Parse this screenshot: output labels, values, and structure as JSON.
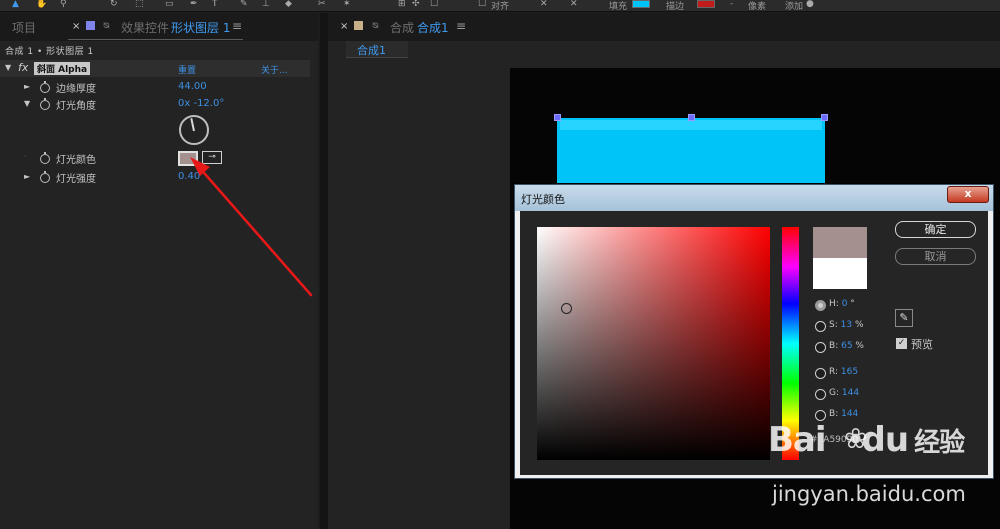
{
  "toolbar": {
    "align_label": "对齐",
    "fill_label": "填充",
    "stroke_label": "描边",
    "px_label": "像素",
    "add_label": "添加",
    "fill_color": "#00c3f7",
    "stroke_color": "#c21b1b"
  },
  "left_panel": {
    "tab_project": "项目",
    "tab_effects_prefix": "效果控件",
    "tab_effects_layer": "形状图层 1",
    "menu_glyph": "≡",
    "breadcrumb": "合成 1 • 形状图层 1",
    "effect": {
      "fx_glyph": "fx",
      "name": "斜面 Alpha",
      "reset": "重置",
      "about": "关于..."
    },
    "properties": [
      {
        "label": "边缘厚度",
        "value": "44.00"
      },
      {
        "label": "灯光角度",
        "value": "0x -12.0°"
      },
      {
        "label": "灯光颜色",
        "value": ""
      },
      {
        "label": "灯光强度",
        "value": "0.40"
      }
    ],
    "light_color": "#a59090"
  },
  "comp_panel": {
    "tab_prefix": "合成",
    "tab_name": "合成1",
    "sub_tab": "合成1",
    "shape_color": "#00c3f7"
  },
  "dialog": {
    "title": "灯光颜色",
    "close_glyph": "x",
    "ok_label": "确定",
    "cancel_label": "取消",
    "new_color": "#a59090",
    "old_color": "#ffffff",
    "fields": [
      {
        "key": "H",
        "value": "0",
        "unit": "°",
        "selected": true
      },
      {
        "key": "S",
        "value": "13",
        "unit": "%",
        "selected": false
      },
      {
        "key": "B",
        "value": "65",
        "unit": "%",
        "selected": false
      },
      {
        "key": "R",
        "value": "165",
        "unit": "",
        "selected": false
      },
      {
        "key": "G",
        "value": "144",
        "unit": "",
        "selected": false
      },
      {
        "key": "B",
        "value": "144",
        "unit": "",
        "selected": false
      }
    ],
    "hex_prefix": "#",
    "hex_value": "A59090",
    "preview_label": "预览",
    "preview_checked": true
  },
  "watermark": {
    "logo": "Bai",
    "logo_suffix": "du",
    "logo_cn": "经验",
    "url": "jingyan.baidu.com"
  },
  "annotation": {
    "arrow_color": "#e81818"
  }
}
